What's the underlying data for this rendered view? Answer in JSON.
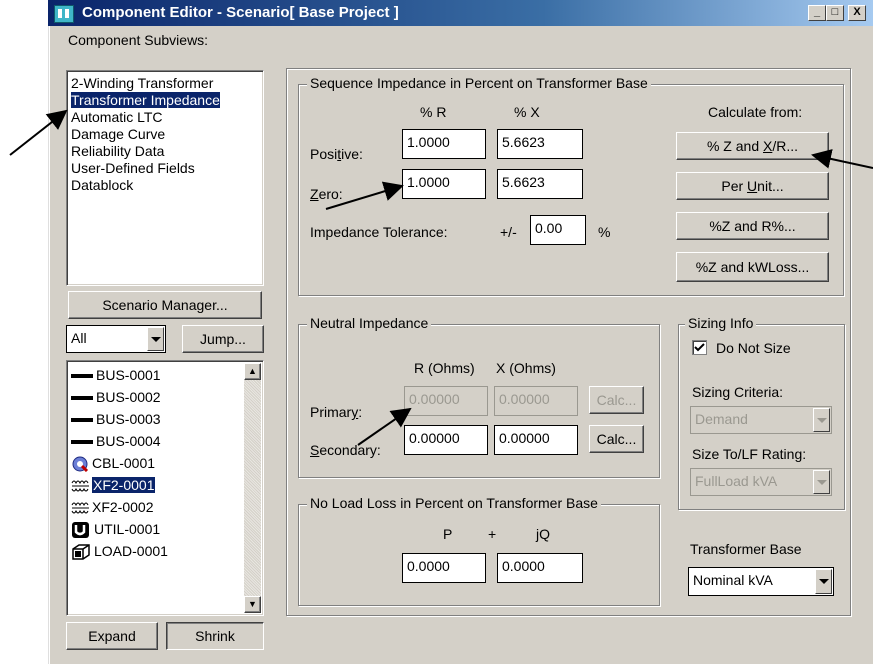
{
  "window": {
    "title": "Component Editor  - Scenario[ Base Project ]",
    "caption_buttons": [
      "_",
      "□",
      "X"
    ]
  },
  "subviews": {
    "label": "Component Subviews:",
    "items": [
      "2-Winding Transformer",
      "Transformer Impedance",
      "Automatic LTC",
      "Damage Curve",
      "Reliability Data",
      "User-Defined Fields",
      "Datablock"
    ],
    "selected_index": 1
  },
  "scenario_button": "Scenario Manager...",
  "filter": {
    "value": "All",
    "jump_label": "Jump..."
  },
  "components": {
    "items": [
      {
        "label": "BUS-0001",
        "icon": "bus-icon"
      },
      {
        "label": "BUS-0002",
        "icon": "bus-icon"
      },
      {
        "label": "BUS-0003",
        "icon": "bus-icon"
      },
      {
        "label": "BUS-0004",
        "icon": "bus-icon"
      },
      {
        "label": "CBL-0001",
        "icon": "cable-icon"
      },
      {
        "label": "XF2-0001",
        "icon": "transformer-icon"
      },
      {
        "label": "XF2-0002",
        "icon": "transformer-icon"
      },
      {
        "label": "UTIL-0001",
        "icon": "utility-icon"
      },
      {
        "label": "LOAD-0001",
        "icon": "load-icon"
      }
    ],
    "selected_index": 5
  },
  "expand_label": "Expand",
  "shrink_label": "Shrink",
  "sequence": {
    "title": "Sequence Impedance in Percent on Transformer Base",
    "col_r": "% R",
    "col_x": "% X",
    "positive_label": "Positive:",
    "positive_r": "1.0000",
    "positive_x": "5.6623",
    "zero_label": "Zero:",
    "zero_r": "1.0000",
    "zero_x": "5.6623",
    "tolerance_label": "Impedance Tolerance:",
    "tolerance_prefix": "+/-",
    "tolerance_value": "0.00",
    "tolerance_unit": "%",
    "calc_from_label": "Calculate from:",
    "calc_buttons": [
      "% Z and X/R...",
      "Per Unit...",
      "%Z and R%...",
      "%Z and kWLoss..."
    ]
  },
  "neutral": {
    "title": "Neutral Impedance",
    "col_r": "R (Ohms)",
    "col_x": "X (Ohms)",
    "primary_label": "Primary:",
    "primary_r": "0.00000",
    "primary_x": "0.00000",
    "secondary_label": "Secondary:",
    "secondary_r": "0.00000",
    "secondary_x": "0.00000",
    "calc_label": "Calc..."
  },
  "sizing": {
    "title": "Sizing Info",
    "do_not_size_label": "Do Not Size",
    "do_not_size_checked": true,
    "criteria_label": "Sizing Criteria:",
    "criteria_value": "Demand",
    "size_to_label": "Size To/LF Rating:",
    "size_to_value": "FullLoad kVA"
  },
  "noload": {
    "title": "No Load Loss in Percent on Transformer Base",
    "p_label": "P",
    "plus": "+",
    "jq_label": "jQ",
    "p_value": "0.0000",
    "jq_value": "0.0000"
  },
  "transformer_base": {
    "label": "Transformer Base",
    "value": "Nominal kVA"
  }
}
